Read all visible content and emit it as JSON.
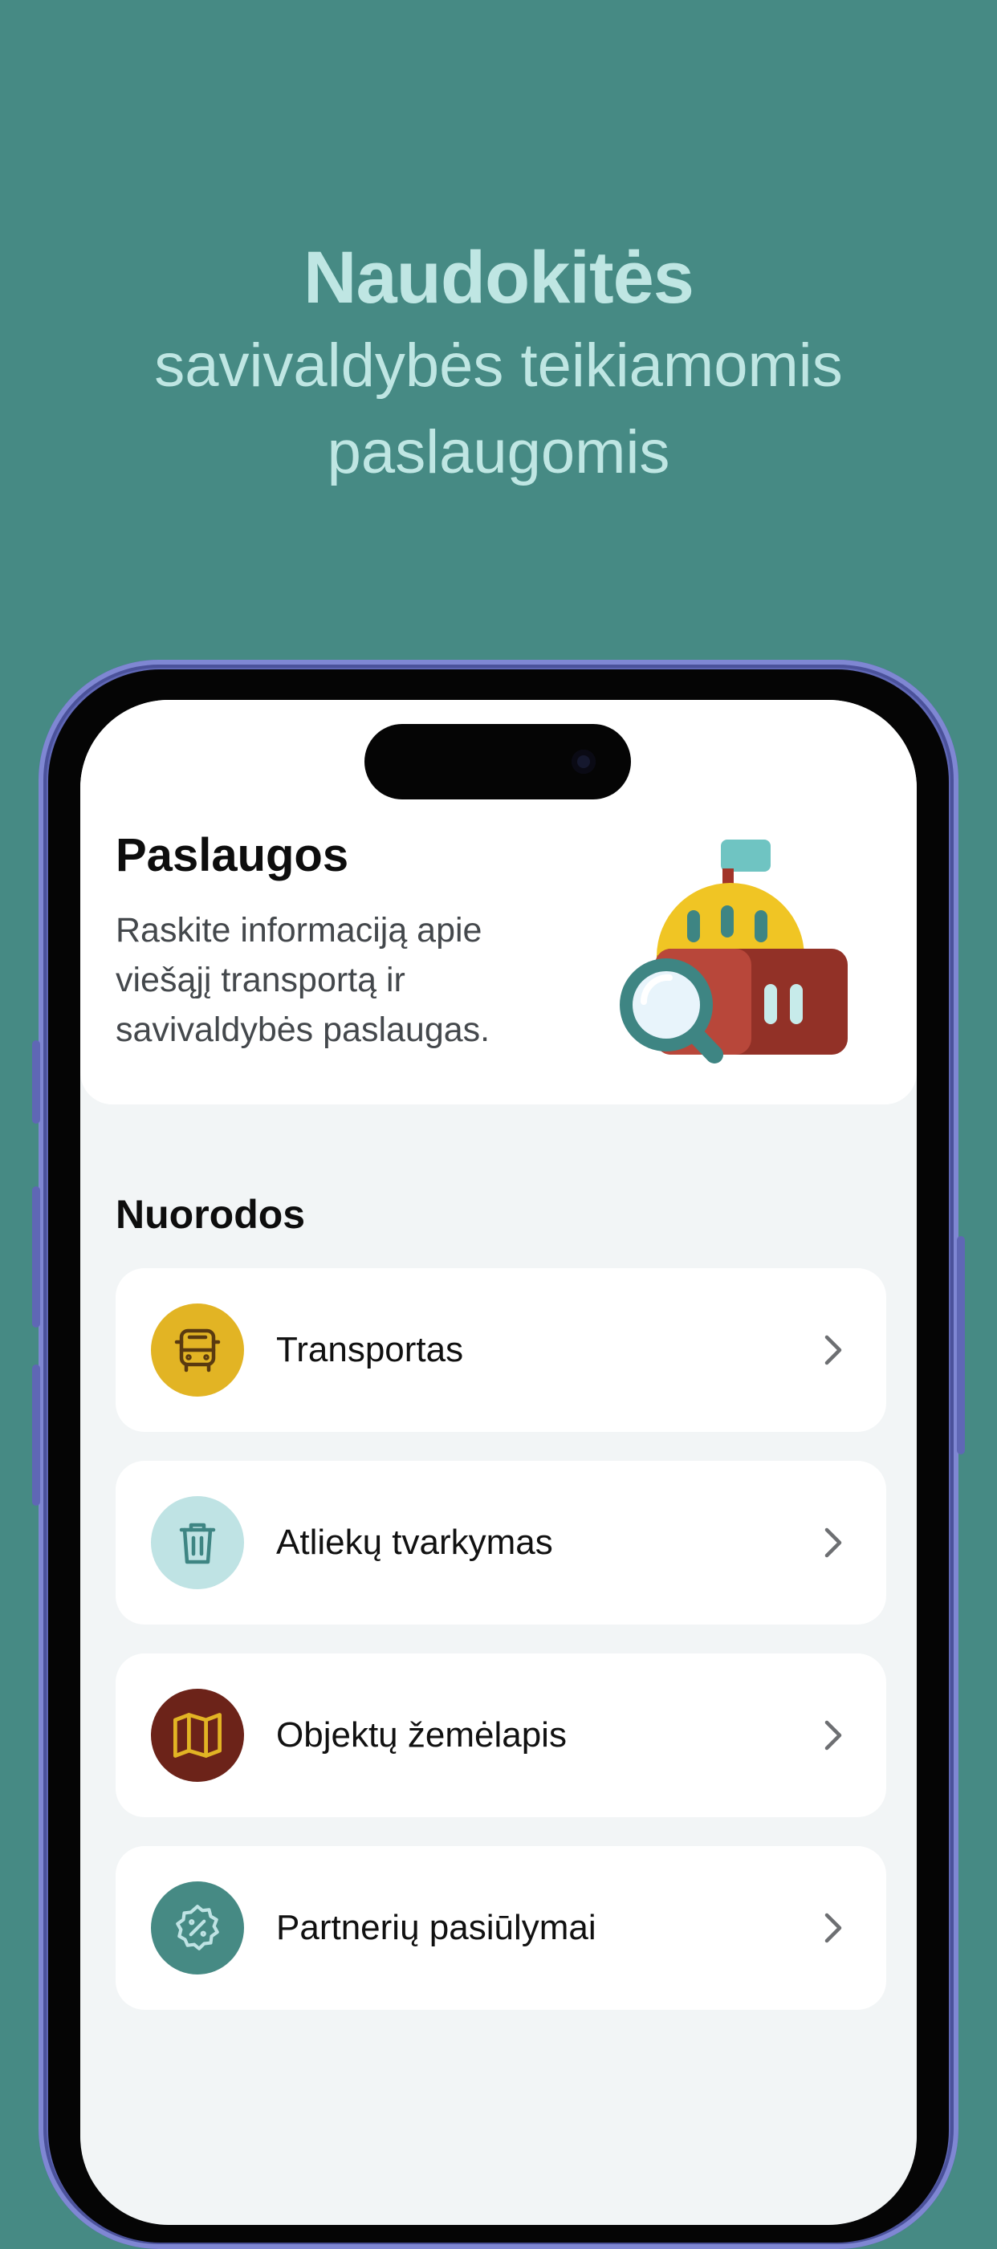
{
  "hero": {
    "title": "Naudokitės",
    "subtitle_line1": "savivaldybės teikiamomis",
    "subtitle_line2": "paslaugomis"
  },
  "header": {
    "title": "Paslaugos",
    "description": "Raskite informaciją apie viešąjį transportą ir savivaldybės paslaugas."
  },
  "links": {
    "section_title": "Nuorodos",
    "items": [
      {
        "label": "Transportas",
        "icon": "bus-icon",
        "color": "#e2b424"
      },
      {
        "label": "Atliekų tvarkymas",
        "icon": "trash-icon",
        "color": "#bfe3e4"
      },
      {
        "label": "Objektų žemėlapis",
        "icon": "map-icon",
        "color": "#6c2319"
      },
      {
        "label": "Partnerių pasiūlymai",
        "icon": "discount-badge-icon",
        "color": "#468a84"
      }
    ]
  },
  "colors": {
    "background": "#468a84",
    "hero_text": "#bfe6e3",
    "phone_frame": "#5f67b5"
  }
}
